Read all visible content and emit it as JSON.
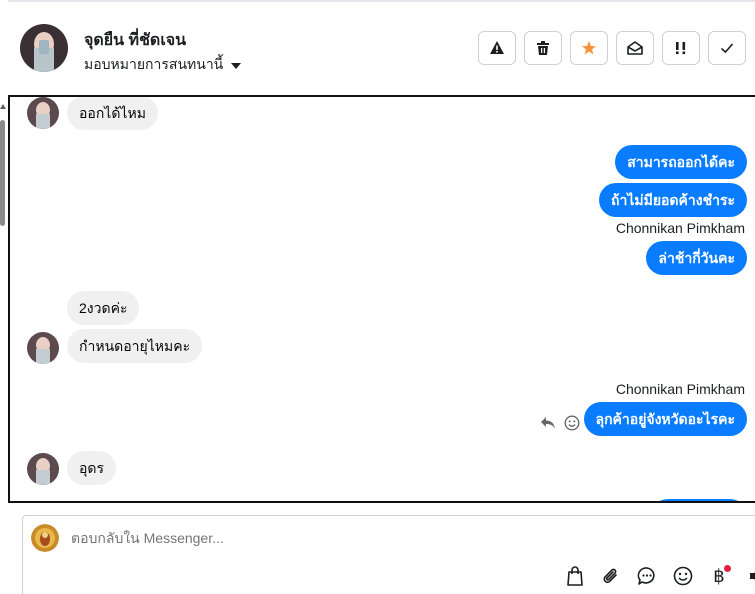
{
  "header": {
    "contact_name": "จุดยืน ที่ชัดเจน",
    "assign_label": "มอบหมายการสนทนานี้"
  },
  "messages": {
    "m1": "ออกได้ไหม",
    "m2": "สามารถออกได้คะ",
    "m3": "ถ้าไม่มียอดค้างชำระ",
    "sender1": "Chonnikan Pimkham",
    "m4": "ล่าช้ากี่วันคะ",
    "m5": "2งวดค่ะ",
    "m6": "กำหนดอายุไหมคะ",
    "sender2": "Chonnikan Pimkham",
    "m7": "ลุกค้าอยู่จังหวัดอะไรคะ",
    "m8": "อุดร"
  },
  "composer": {
    "placeholder": "ตอบกลับใน Messenger..."
  },
  "colors": {
    "outgoing_bubble": "#0a7cff",
    "incoming_bubble": "#f0f0f0",
    "star": "#f7923a",
    "notification_dot": "#e41e3f"
  },
  "icons": [
    "spam-warning-icon",
    "trash-icon",
    "star-icon",
    "mark-unread-icon",
    "follow-up-icon",
    "check-icon",
    "reply-icon",
    "react-emoji-icon",
    "shopping-bag-icon",
    "paperclip-icon",
    "saved-replies-icon",
    "emoji-icon",
    "baht-payment-icon",
    "audio-icon"
  ]
}
